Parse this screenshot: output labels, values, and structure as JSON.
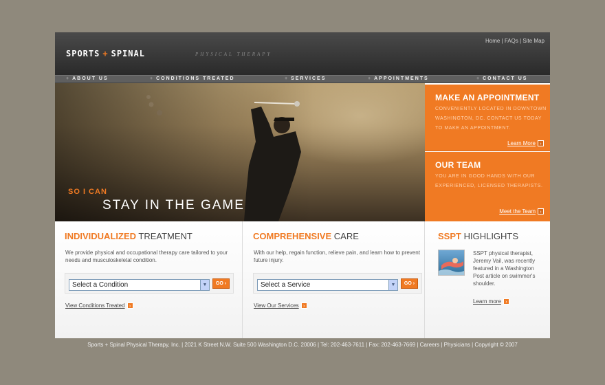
{
  "header": {
    "logo_left": "SPORTS",
    "logo_plus": "+",
    "logo_right": "SPINAL",
    "tagline": "PHYSICAL THERAPY",
    "utility_links": [
      "Home",
      "FAQs",
      "Site Map"
    ],
    "utility_sep": "|"
  },
  "nav": {
    "prefix": "+",
    "items": [
      "ABOUT US",
      "CONDITIONS TREATED",
      "SERVICES",
      "APPOINTMENTS",
      "CONTACT US"
    ]
  },
  "hero": {
    "small": "SO I CAN",
    "big": "STAY IN THE GAME"
  },
  "promos": [
    {
      "title": "MAKE AN APPOINTMENT",
      "text": "CONVENIENTLY LOCATED IN DOWNTOWN WASHINGTON, DC. CONTACT US TODAY TO MAKE AN APPOINTMENT.",
      "link": "Learn More"
    },
    {
      "title": "OUR TEAM",
      "text": "YOU ARE IN GOOD HANDS WITH OUR EXPERIENCED, LICENSED THERAPISTS.",
      "link": "Meet the Team"
    }
  ],
  "columns": [
    {
      "title_hl": "INDIVIDUALIZED",
      "title_rest": "TREATMENT",
      "text": "We provide physical and occupational therapy care tailored to your needs and musculoskeletal condition.",
      "select": "Select a Condition",
      "go": "GO",
      "link": "View Conditions Treated"
    },
    {
      "title_hl": "COMPREHENSIVE",
      "title_rest": "CARE",
      "text": "With our help, regain function, relieve pain, and learn how to prevent future injury.",
      "select": "Select a Service",
      "go": "GO",
      "link": "View Our Services"
    }
  ],
  "highlights": {
    "title_hl": "SSPT",
    "title_rest": "HIGHLIGHTS",
    "text": "SSPT physical therapist, Jeremy Vail, was recently featured in a Washington Post article on swimmer's shoulder.",
    "link": "Learn more"
  },
  "footer": {
    "text": "Sports + Spinal Physical Therapy, Inc. | 2021 K Street N.W. Suite 500 Washington D.C. 20006 | Tel: 202-463-7611 | Fax: 202-463-7669 | Careers | Physicians | Copyright © 2007"
  },
  "colors": {
    "accent": "#f07a23",
    "header": "#333333",
    "background": "#8f897c"
  },
  "icons": {
    "arrow": "arrow-right-icon",
    "dropdown": "chevron-down-icon"
  }
}
